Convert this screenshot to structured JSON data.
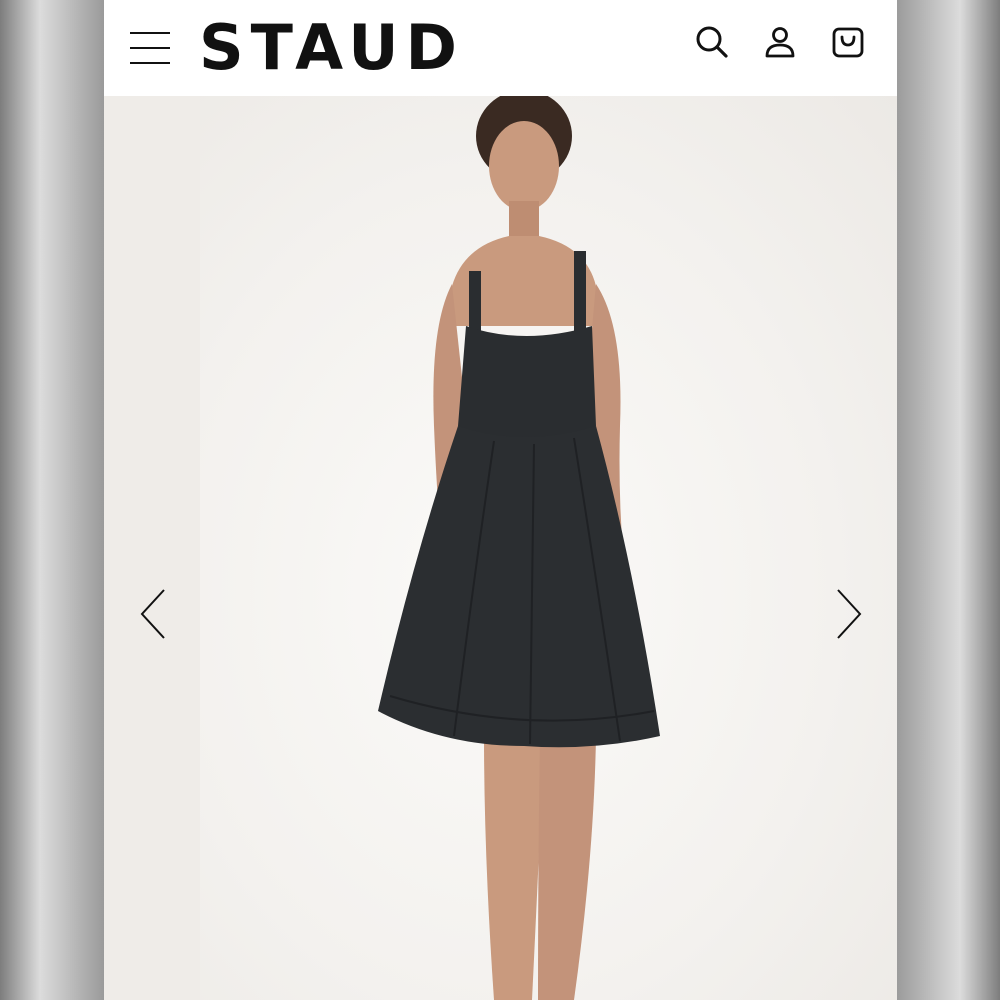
{
  "header": {
    "brand": "STAUD",
    "menu_icon": "hamburger-menu-icon",
    "search_icon": "search-icon",
    "account_icon": "user-account-icon",
    "cart_icon": "shopping-bag-icon"
  },
  "gallery": {
    "prev_icon": "chevron-left-icon",
    "next_icon": "chevron-right-icon",
    "image_subject": "model-wearing-black-flared-mini-dress"
  },
  "colors": {
    "brand_text": "#111111",
    "header_bg": "#ffffff",
    "dress": "#2a2d30",
    "skin": "#c99a7e",
    "backdrop": "#f6f5f3"
  }
}
